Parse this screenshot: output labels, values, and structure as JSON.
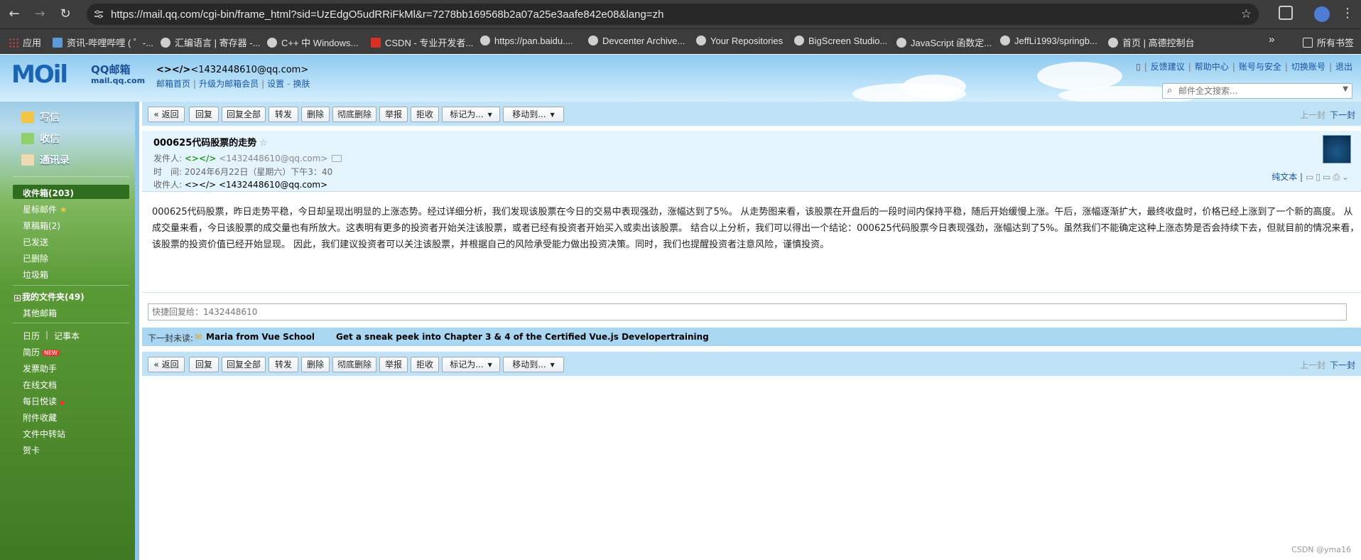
{
  "browser": {
    "url": "https://mail.qq.com/cgi-bin/frame_html?sid=UzEdgO5udRRiFkMl&r=7278bb169568b2a07a25e3aafe842e08&lang=zh",
    "profile_initial": "",
    "bookmarks": [
      "应用",
      "资讯-哔哩哔哩 ( ゜-...",
      "汇编语言 | 寄存器 -...",
      "C++ 中 Windows...",
      "CSDN - 专业开发者...",
      "https://pan.baidu....",
      "Devcenter Archive...",
      "Your Repositories",
      "BigScreen Studio...",
      "JavaScript 函数定...",
      "JeffLi1993/springb...",
      "首页 | 高德控制台"
    ],
    "bookmarks_more": "»",
    "all_bookmarks": "所有书签"
  },
  "header": {
    "logo_mail": "MOil",
    "logo_qq": "QQ邮箱",
    "logo_domain": "mail.qq.com",
    "user_nick": "<></>",
    "user_email": "<1432448610@qq.com>",
    "user_links": [
      "邮箱首页",
      "升级为邮箱会员",
      "设置",
      "换肤"
    ],
    "top_links": [
      "反馈建议",
      "帮助中心",
      "账号与安全",
      "切换账号",
      "退出"
    ],
    "search_placeholder": "邮件全文搜索..."
  },
  "sidebar": {
    "primary": [
      "写信",
      "收信",
      "通讯录"
    ],
    "inbox": "收件箱(203)",
    "folders": [
      "星标邮件",
      "草稿箱(2)",
      "已发送",
      "已删除",
      "垃圾箱"
    ],
    "my_folders": "我的文件夹(49)",
    "other_mailbox": "其他邮箱",
    "calendar": "日历",
    "notes": "记事本",
    "resume": "简历",
    "new_badge": "NEW",
    "tools": [
      "发票助手",
      "在线文档",
      "每日悦读",
      "附件收藏",
      "文件中转站",
      "贺卡"
    ]
  },
  "toolbar": {
    "back": "« 返回",
    "reply": "回复",
    "reply_all": "回复全部",
    "forward": "转发",
    "delete": "删除",
    "perm_delete": "彻底删除",
    "report": "举报",
    "reject": "拒收",
    "mark_as": "标记为...",
    "move_to": "移动到...",
    "prev": "上一封",
    "next": "下一封"
  },
  "mail": {
    "subject": "000625代码股票的走势",
    "from_label": "发件人:",
    "from_nick": "<></>",
    "from_email": "<1432448610@qq.com>",
    "time_label": "时　间:",
    "time": "2024年6月22日（星期六）下午3：40",
    "to_label": "收件人:",
    "to": "<></> <1432448610@qq.com>",
    "plaintext": "纯文本",
    "body": "000625代码股票，昨日走势平稳，今日却呈现出明显的上涨态势。经过详细分析，我们发现该股票在今日的交易中表现强劲，涨幅达到了5%。 从走势图来看，该股票在开盘后的一段时间内保持平稳，随后开始缓慢上涨。午后，涨幅逐渐扩大，最终收盘时，价格已经上涨到了一个新的高度。 从成交量来看，今日该股票的成交量也有所放大。这表明有更多的投资者开始关注该股票，或者已经有投资者开始买入或卖出该股票。 结合以上分析，我们可以得出一个结论：000625代码股票今日表现强劲，涨幅达到了5%。虽然我们不能确定这种上涨态势是否会持续下去，但就目前的情况来看，该股票的投资价值已经开始显现。 因此，我们建议投资者可以关注该股票，并根据自己的风险承受能力做出投资决策。同时，我们也提醒投资者注意风险，谨慎投资。"
  },
  "quick_reply_placeholder": "快捷回复给：1432448610",
  "next_unread": {
    "label": "下一封未读:",
    "from": "Maria from Vue School",
    "subject": "Get a sneak peek into Chapter 3 & 4 of the Certified Vue.js Developertraining"
  },
  "watermark": "CSDN @yma16"
}
